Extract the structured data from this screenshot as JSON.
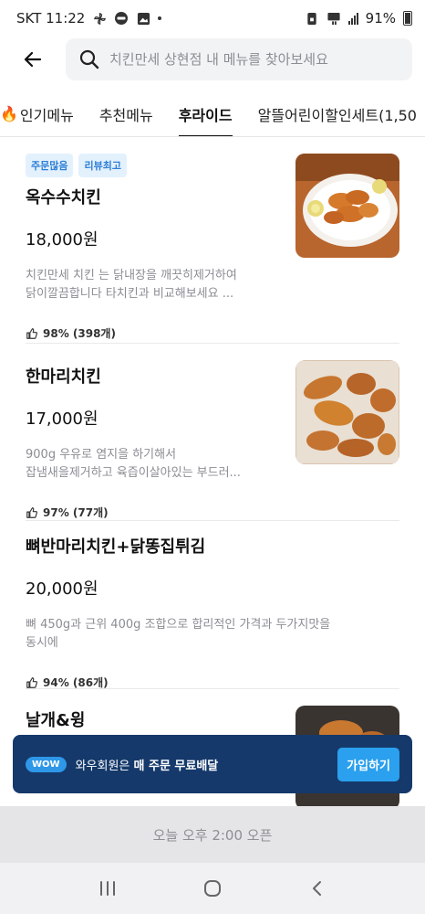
{
  "status_bar": {
    "carrier_time": "SKT 11:22",
    "battery": "91%"
  },
  "search": {
    "placeholder": "치킨만세 상현점 내 메뉴를 찾아보세요"
  },
  "tabs": [
    {
      "label": "인기메뉴",
      "icon": "fire-icon"
    },
    {
      "label": "추천메뉴"
    },
    {
      "label": "후라이드",
      "active": true
    },
    {
      "label": "알뜰어린이할인세트(1,50"
    }
  ],
  "menu": [
    {
      "badges": [
        "주문많음",
        "리뷰최고"
      ],
      "name": "옥수수치킨",
      "price": "18,000원",
      "desc_line1": "치킨만세 치킨 는 닭내장을 깨끗히제거하여",
      "desc_line2": "닭이깔끔합니다 타치킨과 비교해보세요  ...",
      "rating": "98% (398개)"
    },
    {
      "name": "한마리치킨",
      "price": "17,000원",
      "desc_line1": "900g  우유로 염지을  하기해서",
      "desc_line2": "잡냄새을제거하고 육즙이살아있는 부드러...",
      "rating": "97% (77개)"
    },
    {
      "name": "뼈반마리치킨+닭똥집튀김",
      "price": "20,000원",
      "desc_line1": "뼈 450g과 근위 400g 조합으로 합리적인 가격과 두가지맛을",
      "desc_line2": "동시에",
      "rating": "94% (86개)"
    },
    {
      "name": "날개&윙"
    }
  ],
  "wow_banner": {
    "badge": "WOW",
    "text_prefix": "와우회원은 ",
    "text_bold": "매 주문 무료배달",
    "button": "가입하기"
  },
  "open_bar": {
    "text": "오늘 오후 2:00 오픈"
  },
  "colors": {
    "badge_bg": "#e3f1fd",
    "badge_text": "#2f7fd6",
    "banner_bg": "#15396b",
    "join_button": "#2aa0ee"
  }
}
